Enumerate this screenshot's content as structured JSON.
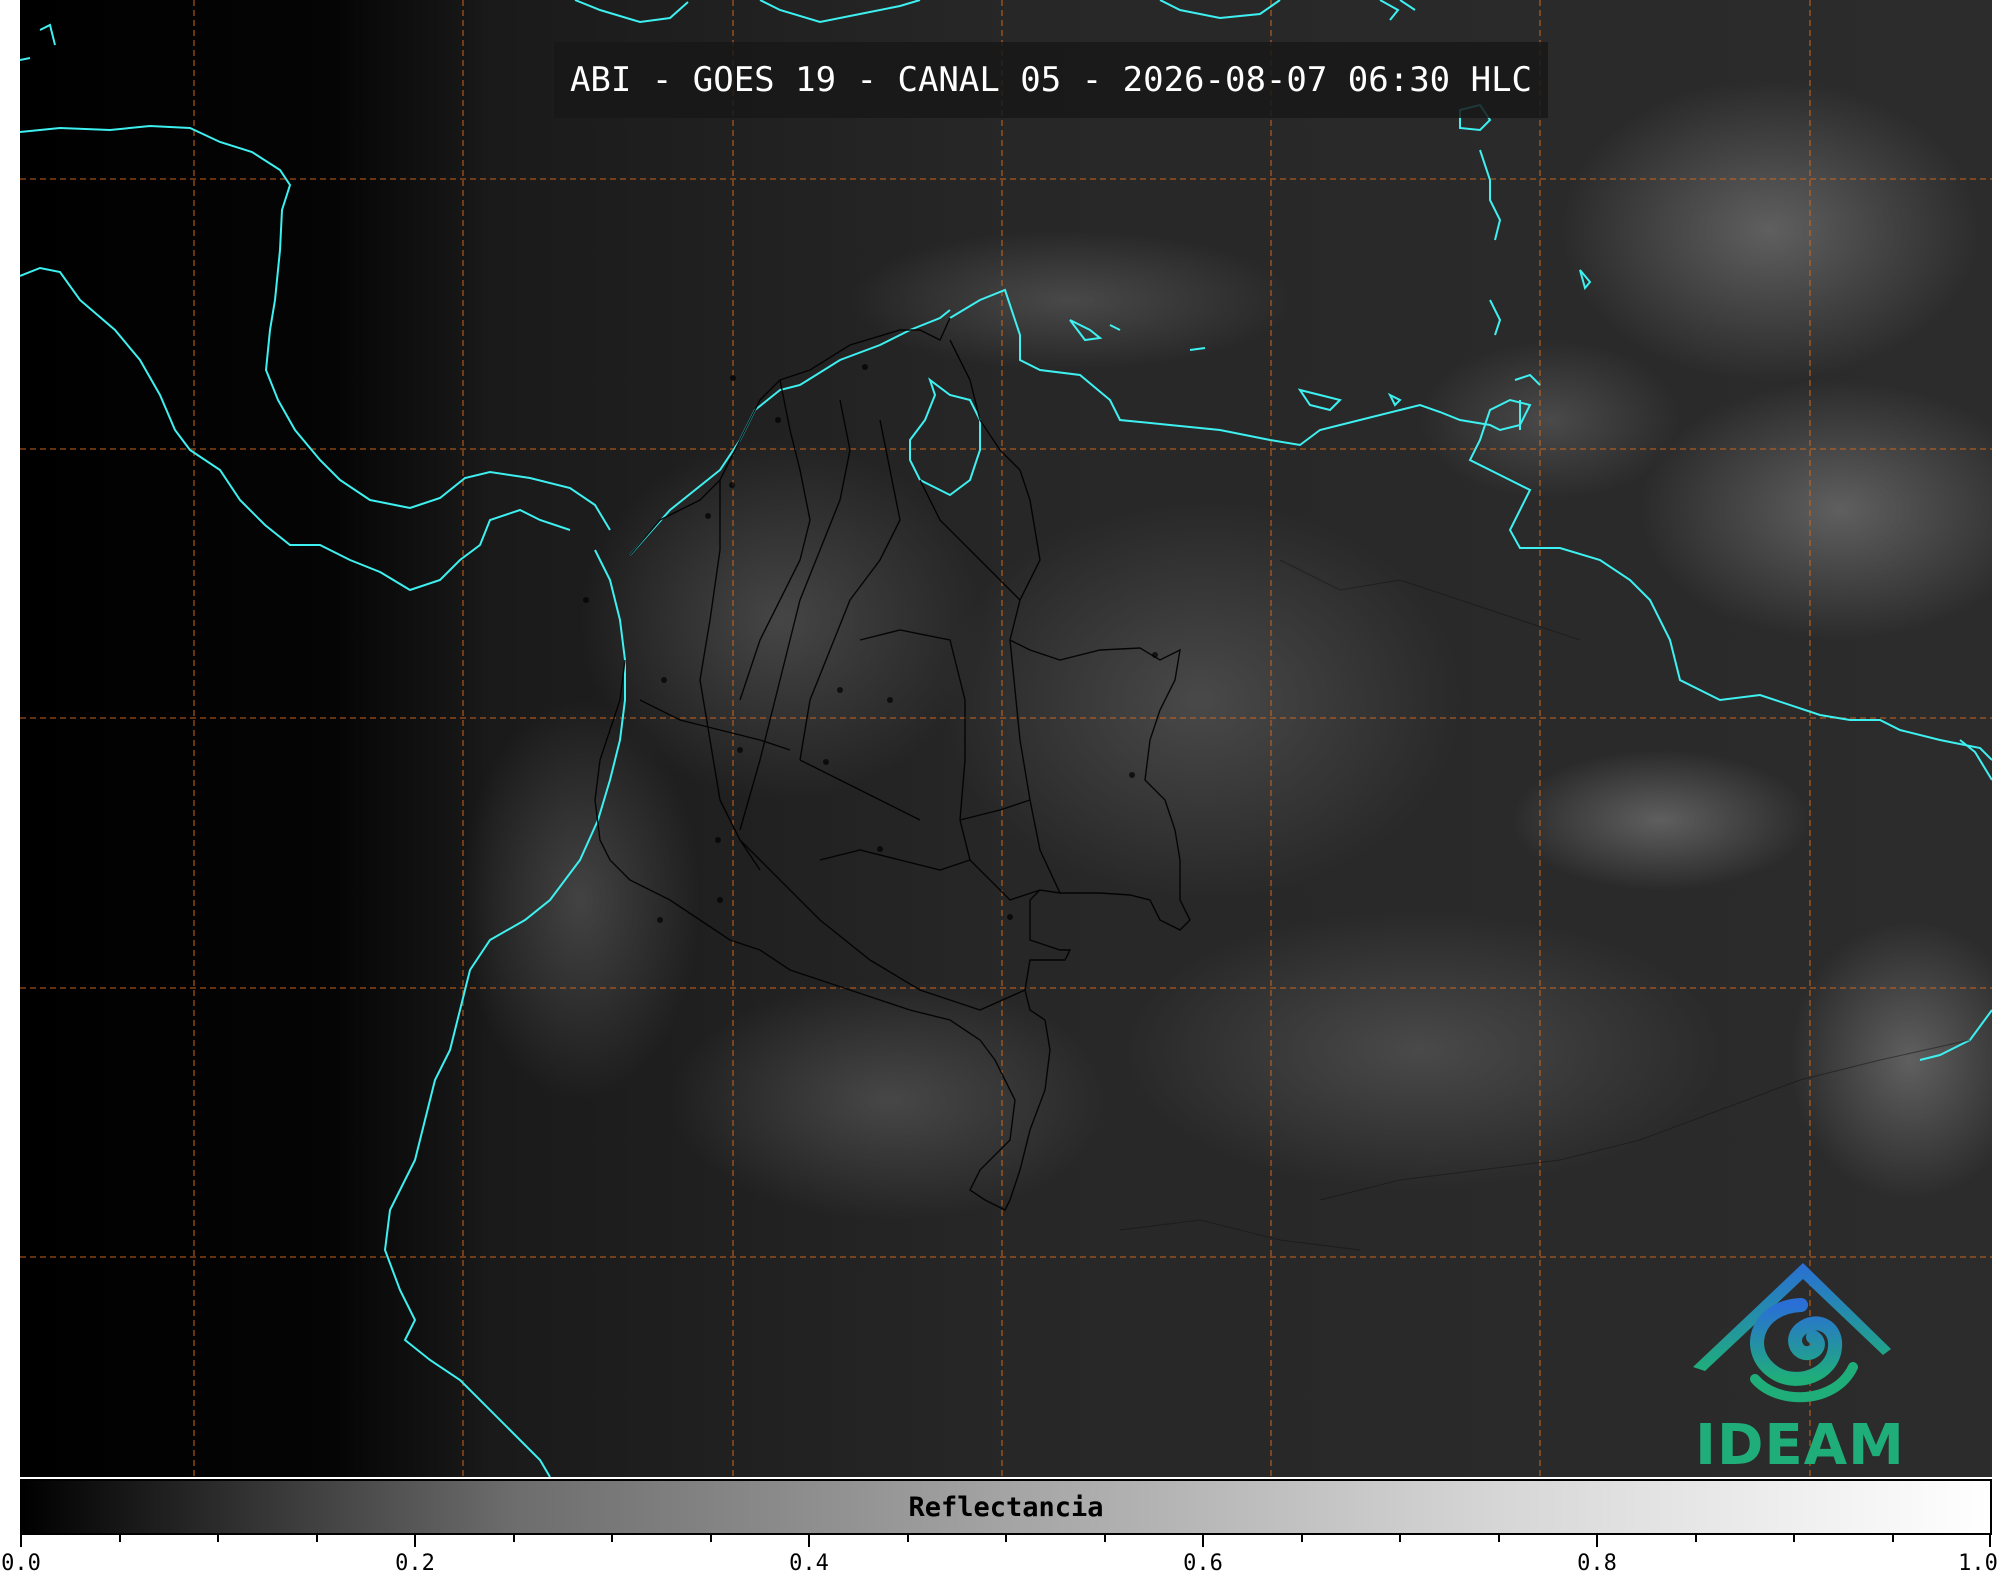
{
  "title": "ABI - GOES 19 - CANAL 05 - 2026-08-07 06:30 HLC",
  "logo": {
    "name": "IDEAM",
    "text": "IDEAM"
  },
  "colorbar": {
    "label": "Reflectancia",
    "range": [
      0.0,
      1.0
    ],
    "tick_labels": [
      "0.0",
      "0.2",
      "0.4",
      "0.6",
      "0.8",
      "1.0"
    ],
    "colormap": "gray"
  },
  "style": {
    "coastline_color": "#3ef0f0",
    "gridline_color": "#d2691e",
    "border_color": "#000000"
  },
  "icons": {
    "logo": "ideam-logo-icon"
  }
}
